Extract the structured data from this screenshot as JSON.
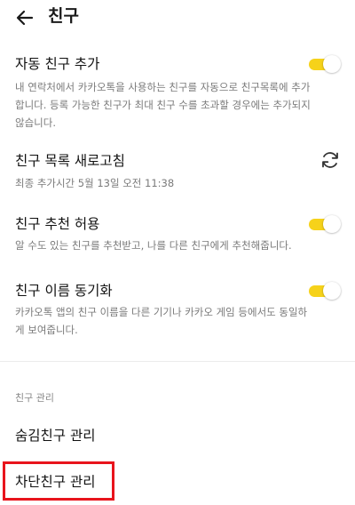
{
  "header": {
    "title": "친구"
  },
  "settings": {
    "auto_add": {
      "title": "자동 친구 추가",
      "desc": "내 연락처에서 카카오톡을 사용하는 친구를 자동으로 친구목록에 추가합니다. 등록 가능한 친구가 최대 친구 수를 초과할 경우에는 추가되지 않습니다.",
      "enabled": true
    },
    "refresh": {
      "title": "친구 목록 새로고침",
      "desc": "최종 추가시간 5월 13일 오전 11:38"
    },
    "recommend": {
      "title": "친구 추천 허용",
      "desc": "알 수도 있는 친구를 추천받고, 나를 다른 친구에게 추천해줍니다.",
      "enabled": true
    },
    "sync_names": {
      "title": "친구 이름 동기화",
      "desc": "카카오톡 앱의 친구 이름을 다른 기기나 카카오 게임 등에서도 동일하게 보여줍니다.",
      "enabled": true
    }
  },
  "manage": {
    "section_label": "친구 관리",
    "hidden_label": "숨김친구 관리",
    "blocked_label": "차단친구 관리"
  },
  "colors": {
    "toggle_on": "#f6d21a",
    "highlight": "#e8141c"
  }
}
